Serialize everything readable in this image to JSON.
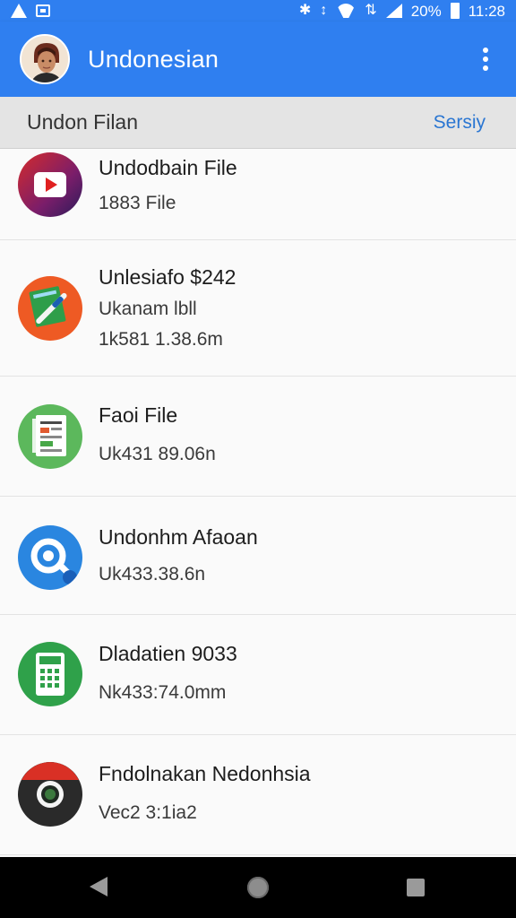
{
  "status_bar": {
    "time": "11:28",
    "battery": "20%",
    "icons": [
      "warning-icon",
      "image-icon",
      "bluetooth-icon",
      "vibrate-icon",
      "wifi-icon",
      "network-icon",
      "signal-icon",
      "battery-icon"
    ]
  },
  "app_bar": {
    "title": "Undonesian",
    "menu_icon": "more-vert-icon"
  },
  "sub_header": {
    "title": "Undon Filan",
    "action": "Sersiy"
  },
  "items": [
    {
      "icon": "youtube-icon",
      "title": "Undodbain File",
      "lines": [
        "1883 File"
      ]
    },
    {
      "icon": "pen-app-icon",
      "title": "Unlesiafo $242",
      "lines": [
        "Ukanam lbll",
        "1k581 1.38.6m"
      ]
    },
    {
      "icon": "document-app-icon",
      "title": "Faoi File",
      "lines": [
        "Uk431 89.06n"
      ]
    },
    {
      "icon": "search-app-icon",
      "title": "Undonhm Afaoan",
      "lines": [
        "Uk433.38.6n"
      ]
    },
    {
      "icon": "calculator-app-icon",
      "title": "Dladatien 9033",
      "lines": [
        "Nk433:74.0mm"
      ]
    },
    {
      "icon": "chrome-app-icon",
      "title": "Fndolnakan Nedonhsia",
      "lines": [
        "Vec2 3:1ia2"
      ]
    }
  ],
  "nav_bar": {
    "back": "back-icon",
    "home": "home-icon",
    "recents": "recents-icon"
  },
  "colors": {
    "app_bar": "#2f7ff0",
    "sub_header_bg": "#e4e4e4",
    "action_text": "#2a76d2",
    "nav_bar": "#000000"
  }
}
